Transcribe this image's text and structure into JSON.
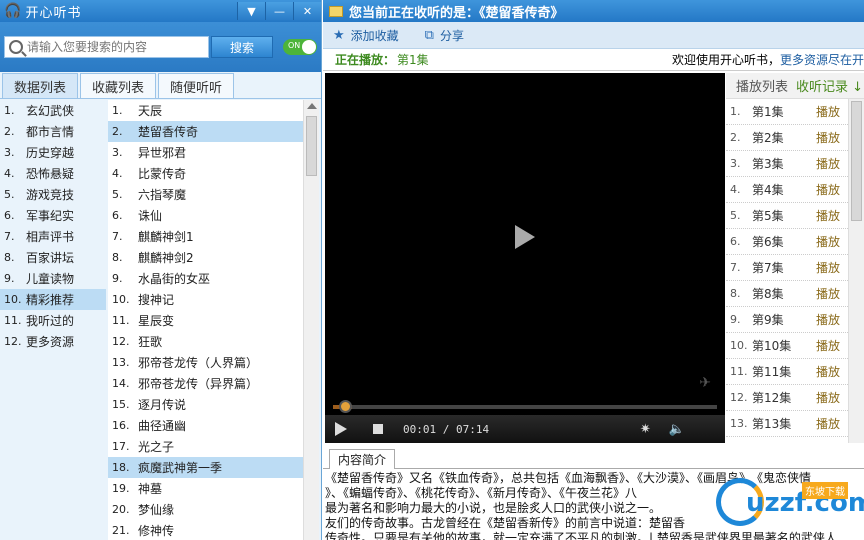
{
  "left": {
    "app_title": "开心听书",
    "search_placeholder": "请输入您要搜索的内容",
    "search_button": "搜索",
    "toggle_label": "ON",
    "tabs": [
      "数据列表",
      "收藏列表",
      "随便听听"
    ],
    "categories": [
      {
        "num": "1.",
        "name": "玄幻武侠"
      },
      {
        "num": "2.",
        "name": "都市言情"
      },
      {
        "num": "3.",
        "name": "历史穿越"
      },
      {
        "num": "4.",
        "name": "恐怖悬疑"
      },
      {
        "num": "5.",
        "name": "游戏竞技"
      },
      {
        "num": "6.",
        "name": "军事纪实"
      },
      {
        "num": "7.",
        "name": "相声评书"
      },
      {
        "num": "8.",
        "name": "百家讲坛"
      },
      {
        "num": "9.",
        "name": "儿童读物"
      },
      {
        "num": "10.",
        "name": "精彩推荐"
      },
      {
        "num": "11.",
        "name": "我听过的"
      },
      {
        "num": "12.",
        "name": "更多资源"
      }
    ],
    "selected_category": "精彩推荐",
    "books": [
      {
        "num": "1.",
        "name": "天辰"
      },
      {
        "num": "2.",
        "name": "楚留香传奇"
      },
      {
        "num": "3.",
        "name": "异世邪君"
      },
      {
        "num": "4.",
        "name": "比蒙传奇"
      },
      {
        "num": "5.",
        "name": "六指琴魔"
      },
      {
        "num": "6.",
        "name": "诛仙"
      },
      {
        "num": "7.",
        "name": "麒麟神剑1"
      },
      {
        "num": "8.",
        "name": "麒麟神剑2"
      },
      {
        "num": "9.",
        "name": "水晶街的女巫"
      },
      {
        "num": "10.",
        "name": "搜神记"
      },
      {
        "num": "11.",
        "name": "星辰变"
      },
      {
        "num": "12.",
        "name": "狂歌"
      },
      {
        "num": "13.",
        "name": "邪帝苍龙传（人界篇）"
      },
      {
        "num": "14.",
        "name": "邪帝苍龙传（异界篇）"
      },
      {
        "num": "15.",
        "name": "逐月传说"
      },
      {
        "num": "16.",
        "name": "曲径通幽"
      },
      {
        "num": "17.",
        "name": "光之子"
      },
      {
        "num": "18.",
        "name": "疯魔武神第一季"
      },
      {
        "num": "19.",
        "name": "神墓"
      },
      {
        "num": "20.",
        "name": "梦仙缘"
      },
      {
        "num": "21.",
        "name": "修神传"
      }
    ],
    "selected_books": [
      "楚留香传奇",
      "疯魔武神第一季"
    ]
  },
  "right": {
    "title": "您当前正在收听的是：《楚留香传奇》",
    "add_favorite": "添加收藏",
    "share": "分享",
    "now_playing_label": "正在播放：",
    "now_playing_episode": "第1集",
    "welcome": "欢迎使用开心听书，",
    "more_link": "更多资源尽在开",
    "time": "00:01 / 07:14",
    "progress": 0.05,
    "playlist_tab": "播放列表",
    "history_tab": "收听记录 ↓",
    "play_label": "播放",
    "playlist": [
      {
        "num": "1.",
        "ep": "第1集"
      },
      {
        "num": "2.",
        "ep": "第2集"
      },
      {
        "num": "3.",
        "ep": "第3集"
      },
      {
        "num": "4.",
        "ep": "第4集"
      },
      {
        "num": "5.",
        "ep": "第5集"
      },
      {
        "num": "6.",
        "ep": "第6集"
      },
      {
        "num": "7.",
        "ep": "第7集"
      },
      {
        "num": "8.",
        "ep": "第8集"
      },
      {
        "num": "9.",
        "ep": "第9集"
      },
      {
        "num": "10.",
        "ep": "第10集"
      },
      {
        "num": "11.",
        "ep": "第11集"
      },
      {
        "num": "12.",
        "ep": "第12集"
      },
      {
        "num": "13.",
        "ep": "第13集"
      }
    ],
    "intro_tab": "内容简介",
    "intro_lines": [
      "《楚留香传奇》又名《铁血传奇》，总共包括《血海飘香》、《大沙漠》、《画眉鸟》、《鬼恋侠情",
      "》、《蝙蝠传奇》、《桃花传奇》、《新月传奇》、《午夜兰花》八",
      "最为著名和影响力最大的小说，也是脍炙人口的武侠小说之一。",
      "友们的传奇故事。古龙曾经在《楚留香新传》的前言中说道：楚留香",
      "传奇性。只要是有关他的故事，就一定充满了不平凡的刺激。|     楚留香是武侠界里最著名的武侠人"
    ],
    "site_logo_text": "uzzf.com",
    "site_logo_sub": "东坡下载"
  },
  "colors": {
    "title_bar": "#2e84cf",
    "selected_row": "#bcdcf4",
    "green": "#3d8a1f"
  }
}
